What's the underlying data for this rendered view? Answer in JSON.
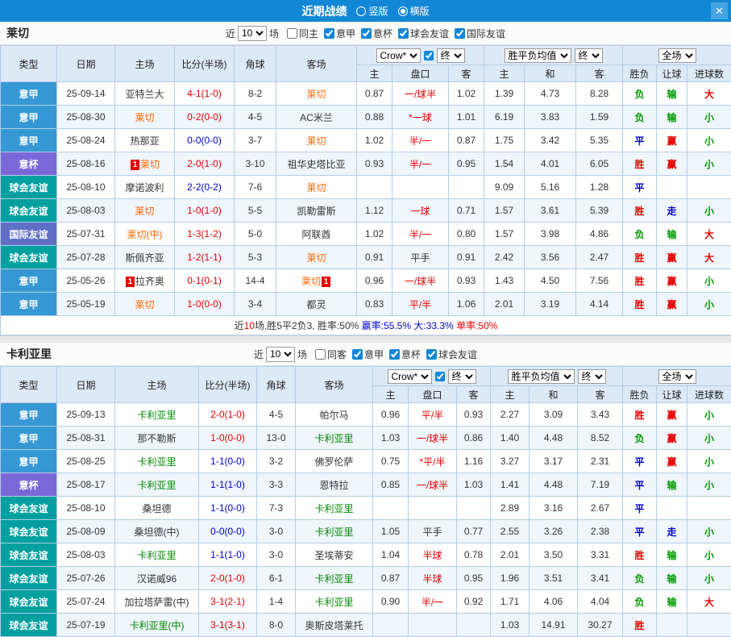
{
  "colors": {
    "red": "#e60000",
    "green": "#009900",
    "blue": "#0000cc",
    "black": "#333333",
    "home_team": "#ff6600",
    "away_team": "#008800",
    "titlebar_bg": "#1287d6",
    "type_badges": {
      "意甲": "#3598d4",
      "意杯": "#7b68d8",
      "球会友谊": "#00a0a0",
      "国际友谊": "#5f6fc6"
    }
  },
  "titlebar": {
    "title": "近期战绩",
    "radios": [
      {
        "label": "竖版",
        "checked": false
      },
      {
        "label": "横版",
        "checked": true
      }
    ],
    "close_icon": "✕"
  },
  "table_header": {
    "type": "类型",
    "date": "日期",
    "home": "主场",
    "score": "比分(半场)",
    "corner": "角球",
    "away": "客场",
    "odds_provider": "Crow*",
    "final": "终",
    "avg": "胜平负均值",
    "final2": "终",
    "full": "全场",
    "sub": [
      "主",
      "盘口",
      "客",
      "主",
      "和",
      "客",
      "胜负",
      "让球",
      "进球数"
    ]
  },
  "sections": [
    {
      "team": "莱切",
      "filter": {
        "near": "近",
        "count": "10",
        "games": "场",
        "checks": [
          {
            "label": "同主",
            "checked": false
          },
          {
            "label": "意甲",
            "checked": true
          },
          {
            "label": "意杯",
            "checked": true
          },
          {
            "label": "球会友谊",
            "checked": true
          },
          {
            "label": "国际友谊",
            "checked": true
          }
        ]
      },
      "rows": [
        {
          "lg": "意甲",
          "dt": "25-09-14",
          "hm": "亚特兰大",
          "hmc": "black",
          "hb": false,
          "sc": "4-1(1-0)",
          "scc": "red",
          "cn": "8-2",
          "aw": "莱切",
          "awc": "home_team",
          "ab": false,
          "o1": "0.87",
          "hc": "一/球半",
          "hcc": "red",
          "o2": "1.02",
          "a1": "1.39",
          "a2": "4.73",
          "a3": "8.28",
          "rs": "负",
          "rsc": "green",
          "hr": "输",
          "hrc": "green",
          "gl": "大",
          "glc": "red"
        },
        {
          "lg": "意甲",
          "dt": "25-08-30",
          "hm": "莱切",
          "hmc": "home_team",
          "hb": false,
          "sc": "0-2(0-0)",
          "scc": "red",
          "cn": "4-5",
          "aw": "AC米兰",
          "awc": "black",
          "ab": false,
          "o1": "0.88",
          "hc": "*一球",
          "hcc": "red",
          "o2": "1.01",
          "a1": "6.19",
          "a2": "3.83",
          "a3": "1.59",
          "rs": "负",
          "rsc": "green",
          "hr": "输",
          "hrc": "green",
          "gl": "小",
          "glc": "green"
        },
        {
          "lg": "意甲",
          "dt": "25-08-24",
          "hm": "热那亚",
          "hmc": "black",
          "hb": false,
          "sc": "0-0(0-0)",
          "scc": "blue",
          "cn": "3-7",
          "aw": "莱切",
          "awc": "home_team",
          "ab": false,
          "o1": "1.02",
          "hc": "半/一",
          "hcc": "red",
          "o2": "0.87",
          "a1": "1.75",
          "a2": "3.42",
          "a3": "5.35",
          "rs": "平",
          "rsc": "blue",
          "hr": "赢",
          "hrc": "red",
          "gl": "小",
          "glc": "green"
        },
        {
          "lg": "意杯",
          "dt": "25-08-16",
          "hm": "莱切",
          "hmc": "home_team",
          "hb": true,
          "sc": "2-0(1-0)",
          "scc": "red",
          "cn": "3-10",
          "aw": "祖华史塔比亚",
          "awc": "black",
          "ab": false,
          "o1": "0.93",
          "hc": "半/一",
          "hcc": "red",
          "o2": "0.95",
          "a1": "1.54",
          "a2": "4.01",
          "a3": "6.05",
          "rs": "胜",
          "rsc": "red",
          "hr": "赢",
          "hrc": "red",
          "gl": "小",
          "glc": "green"
        },
        {
          "lg": "球会友谊",
          "dt": "25-08-10",
          "hm": "摩诺波利",
          "hmc": "black",
          "hb": false,
          "sc": "2-2(0-2)",
          "scc": "blue",
          "cn": "7-6",
          "aw": "莱切",
          "awc": "home_team",
          "ab": false,
          "o1": "",
          "hc": "",
          "hcc": "black",
          "o2": "",
          "a1": "9.09",
          "a2": "5.16",
          "a3": "1.28",
          "rs": "平",
          "rsc": "blue",
          "hr": "",
          "hrc": "black",
          "gl": "",
          "glc": "black"
        },
        {
          "lg": "球会友谊",
          "dt": "25-08-03",
          "hm": "莱切",
          "hmc": "home_team",
          "hb": false,
          "sc": "1-0(1-0)",
          "scc": "red",
          "cn": "5-5",
          "aw": "凯勒雷斯",
          "awc": "black",
          "ab": false,
          "o1": "1.12",
          "hc": "一球",
          "hcc": "red",
          "o2": "0.71",
          "a1": "1.57",
          "a2": "3.61",
          "a3": "5.39",
          "rs": "胜",
          "rsc": "red",
          "hr": "走",
          "hrc": "blue",
          "gl": "小",
          "glc": "green"
        },
        {
          "lg": "国际友谊",
          "dt": "25-07-31",
          "hm": "莱切(中)",
          "hmc": "home_team",
          "hb": false,
          "sc": "1-3(1-2)",
          "scc": "red",
          "cn": "5-0",
          "aw": "阿联酋",
          "awc": "black",
          "ab": false,
          "o1": "1.02",
          "hc": "半/一",
          "hcc": "red",
          "o2": "0.80",
          "a1": "1.57",
          "a2": "3.98",
          "a3": "4.86",
          "rs": "负",
          "rsc": "green",
          "hr": "输",
          "hrc": "green",
          "gl": "大",
          "glc": "red"
        },
        {
          "lg": "球会友谊",
          "dt": "25-07-28",
          "hm": "斯佩齐亚",
          "hmc": "black",
          "hb": false,
          "sc": "1-2(1-1)",
          "scc": "red",
          "cn": "5-3",
          "aw": "莱切",
          "awc": "home_team",
          "ab": false,
          "o1": "0.91",
          "hc": "平手",
          "hcc": "black",
          "o2": "0.91",
          "a1": "2.42",
          "a2": "3.56",
          "a3": "2.47",
          "rs": "胜",
          "rsc": "red",
          "hr": "赢",
          "hrc": "red",
          "gl": "大",
          "glc": "red"
        },
        {
          "lg": "意甲",
          "dt": "25-05-26",
          "hm": "拉齐奥",
          "hmc": "black",
          "hb": true,
          "sc": "0-1(0-1)",
          "scc": "red",
          "cn": "14-4",
          "aw": "莱切",
          "awc": "home_team",
          "ab": true,
          "o1": "0.96",
          "hc": "一/球半",
          "hcc": "red",
          "o2": "0.93",
          "a1": "1.43",
          "a2": "4.50",
          "a3": "7.56",
          "rs": "胜",
          "rsc": "red",
          "hr": "赢",
          "hrc": "red",
          "gl": "小",
          "glc": "green"
        },
        {
          "lg": "意甲",
          "dt": "25-05-19",
          "hm": "莱切",
          "hmc": "home_team",
          "hb": false,
          "sc": "1-0(0-0)",
          "scc": "red",
          "cn": "3-4",
          "aw": "都灵",
          "awc": "black",
          "ab": false,
          "o1": "0.83",
          "hc": "平/半",
          "hcc": "red",
          "o2": "1.06",
          "a1": "2.01",
          "a2": "3.19",
          "a3": "4.14",
          "rs": "胜",
          "rsc": "red",
          "hr": "赢",
          "hrc": "red",
          "gl": "小",
          "glc": "green"
        }
      ],
      "footer": [
        {
          "t": "近",
          "c": "black"
        },
        {
          "t": "10",
          "c": "red"
        },
        {
          "t": "场,胜5平2负3, 胜率:50% ",
          "c": "black"
        },
        {
          "t": "赢率:55.5% ",
          "c": "blue"
        },
        {
          "t": "大:33.3% ",
          "c": "blue"
        },
        {
          "t": "单率:50%",
          "c": "red"
        }
      ]
    },
    {
      "team": "卡利亚里",
      "filter": {
        "near": "近",
        "count": "10",
        "games": "场",
        "checks": [
          {
            "label": "同客",
            "checked": false
          },
          {
            "label": "意甲",
            "checked": true
          },
          {
            "label": "意杯",
            "checked": true
          },
          {
            "label": "球会友谊",
            "checked": true
          }
        ]
      },
      "rows": [
        {
          "lg": "意甲",
          "dt": "25-09-13",
          "hm": "卡利亚里",
          "hmc": "away_team",
          "hb": false,
          "sc": "2-0(1-0)",
          "scc": "red",
          "cn": "4-5",
          "aw": "帕尔马",
          "awc": "black",
          "ab": false,
          "o1": "0.96",
          "hc": "平/半",
          "hcc": "red",
          "o2": "0.93",
          "a1": "2.27",
          "a2": "3.09",
          "a3": "3.43",
          "rs": "胜",
          "rsc": "red",
          "hr": "赢",
          "hrc": "red",
          "gl": "小",
          "glc": "green"
        },
        {
          "lg": "意甲",
          "dt": "25-08-31",
          "hm": "那不勒斯",
          "hmc": "black",
          "hb": false,
          "sc": "1-0(0-0)",
          "scc": "red",
          "cn": "13-0",
          "aw": "卡利亚里",
          "awc": "away_team",
          "ab": false,
          "o1": "1.03",
          "hc": "一/球半",
          "hcc": "red",
          "o2": "0.86",
          "a1": "1.40",
          "a2": "4.48",
          "a3": "8.52",
          "rs": "负",
          "rsc": "green",
          "hr": "赢",
          "hrc": "red",
          "gl": "小",
          "glc": "green"
        },
        {
          "lg": "意甲",
          "dt": "25-08-25",
          "hm": "卡利亚里",
          "hmc": "away_team",
          "hb": false,
          "sc": "1-1(0-0)",
          "scc": "blue",
          "cn": "3-2",
          "aw": "佛罗伦萨",
          "awc": "black",
          "ab": false,
          "o1": "0.75",
          "hc": "*平/半",
          "hcc": "red",
          "o2": "1.16",
          "a1": "3.27",
          "a2": "3.17",
          "a3": "2.31",
          "rs": "平",
          "rsc": "blue",
          "hr": "赢",
          "hrc": "red",
          "gl": "小",
          "glc": "green"
        },
        {
          "lg": "意杯",
          "dt": "25-08-17",
          "hm": "卡利亚里",
          "hmc": "away_team",
          "hb": false,
          "sc": "1-1(1-0)",
          "scc": "blue",
          "cn": "3-3",
          "aw": "恩特拉",
          "awc": "black",
          "ab": false,
          "o1": "0.85",
          "hc": "一/球半",
          "hcc": "red",
          "o2": "1.03",
          "a1": "1.41",
          "a2": "4.48",
          "a3": "7.19",
          "rs": "平",
          "rsc": "blue",
          "hr": "输",
          "hrc": "green",
          "gl": "小",
          "glc": "green"
        },
        {
          "lg": "球会友谊",
          "dt": "25-08-10",
          "hm": "桑坦德",
          "hmc": "black",
          "hb": false,
          "sc": "1-1(0-0)",
          "scc": "blue",
          "cn": "7-3",
          "aw": "卡利亚里",
          "awc": "away_team",
          "ab": false,
          "o1": "",
          "hc": "",
          "hcc": "black",
          "o2": "",
          "a1": "2.89",
          "a2": "3.16",
          "a3": "2.67",
          "rs": "平",
          "rsc": "blue",
          "hr": "",
          "hrc": "black",
          "gl": "",
          "glc": "black"
        },
        {
          "lg": "球会友谊",
          "dt": "25-08-09",
          "hm": "桑坦德(中)",
          "hmc": "black",
          "hb": false,
          "sc": "0-0(0-0)",
          "scc": "blue",
          "cn": "3-0",
          "aw": "卡利亚里",
          "awc": "away_team",
          "ab": false,
          "o1": "1.05",
          "hc": "平手",
          "hcc": "black",
          "o2": "0.77",
          "a1": "2.55",
          "a2": "3.26",
          "a3": "2.38",
          "rs": "平",
          "rsc": "blue",
          "hr": "走",
          "hrc": "blue",
          "gl": "小",
          "glc": "green"
        },
        {
          "lg": "球会友谊",
          "dt": "25-08-03",
          "hm": "卡利亚里",
          "hmc": "away_team",
          "hb": false,
          "sc": "1-1(1-0)",
          "scc": "blue",
          "cn": "3-0",
          "aw": "圣埃蒂安",
          "awc": "black",
          "ab": false,
          "o1": "1.04",
          "hc": "半球",
          "hcc": "red",
          "o2": "0.78",
          "a1": "2.01",
          "a2": "3.50",
          "a3": "3.31",
          "rs": "胜",
          "rsc": "red",
          "hr": "输",
          "hrc": "green",
          "gl": "小",
          "glc": "green"
        },
        {
          "lg": "球会友谊",
          "dt": "25-07-26",
          "hm": "汉诺威96",
          "hmc": "black",
          "hb": false,
          "sc": "2-0(1-0)",
          "scc": "red",
          "cn": "6-1",
          "aw": "卡利亚里",
          "awc": "away_team",
          "ab": false,
          "o1": "0.87",
          "hc": "半球",
          "hcc": "red",
          "o2": "0.95",
          "a1": "1.96",
          "a2": "3.51",
          "a3": "3.41",
          "rs": "负",
          "rsc": "green",
          "hr": "输",
          "hrc": "green",
          "gl": "小",
          "glc": "green"
        },
        {
          "lg": "球会友谊",
          "dt": "25-07-24",
          "hm": "加拉塔萨雷(中)",
          "hmc": "black",
          "hb": false,
          "sc": "3-1(2-1)",
          "scc": "red",
          "cn": "1-4",
          "aw": "卡利亚里",
          "awc": "away_team",
          "ab": false,
          "o1": "0.90",
          "hc": "半/一",
          "hcc": "red",
          "o2": "0.92",
          "a1": "1.71",
          "a2": "4.06",
          "a3": "4.04",
          "rs": "负",
          "rsc": "green",
          "hr": "输",
          "hrc": "green",
          "gl": "大",
          "glc": "red"
        },
        {
          "lg": "球会友谊",
          "dt": "25-07-19",
          "hm": "卡利亚里(中)",
          "hmc": "away_team",
          "hb": false,
          "sc": "3-1(3-1)",
          "scc": "red",
          "cn": "8-0",
          "aw": "奥斯皮塔莱托",
          "awc": "black",
          "ab": false,
          "o1": "",
          "hc": "",
          "hcc": "black",
          "o2": "",
          "a1": "1.03",
          "a2": "14.91",
          "a3": "30.27",
          "rs": "胜",
          "rsc": "red",
          "hr": "",
          "hrc": "black",
          "gl": "",
          "glc": "black"
        }
      ]
    }
  ]
}
